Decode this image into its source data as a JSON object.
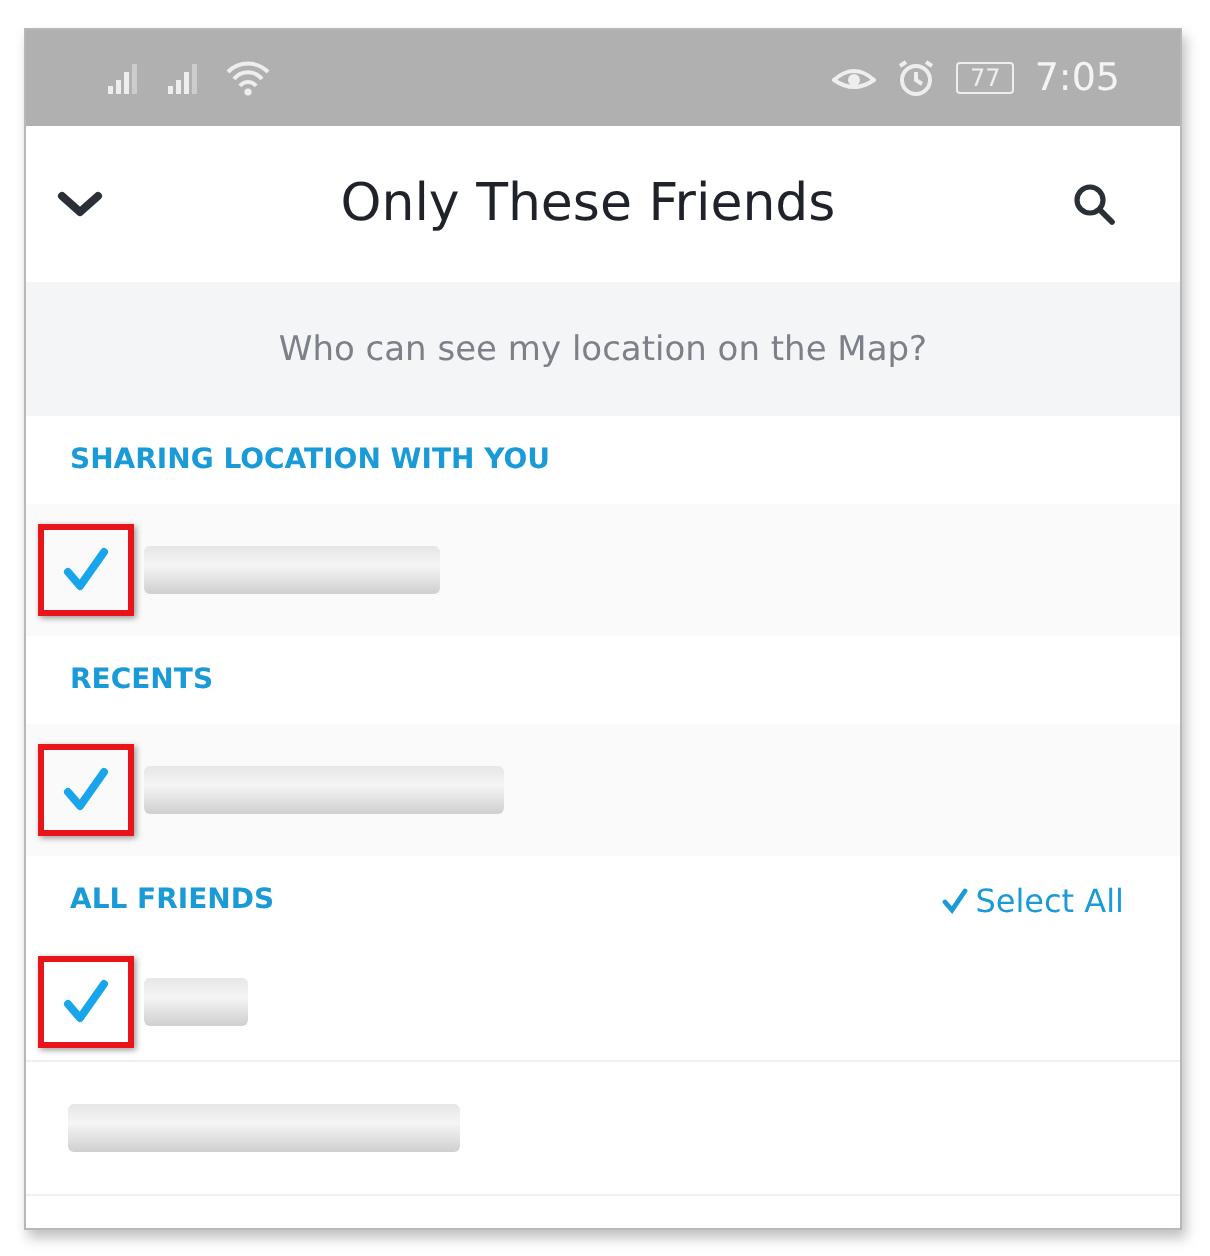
{
  "status_bar": {
    "battery": "77",
    "time": "7:05"
  },
  "header": {
    "title": "Only These Friends"
  },
  "prompt": "Who can see my location on the Map?",
  "sections": [
    {
      "heading": "SHARING LOCATION WITH YOU",
      "items": [
        {
          "kind": "checkbox",
          "checked": true,
          "highlighted": true
        }
      ]
    },
    {
      "heading": "RECENTS",
      "items": [
        {
          "kind": "checkbox",
          "checked": true,
          "highlighted": true
        }
      ]
    },
    {
      "heading": "ALL FRIENDS",
      "action": "Select All",
      "items": [
        {
          "kind": "checkbox",
          "checked": true,
          "highlighted": true
        },
        {
          "kind": "plain"
        }
      ]
    }
  ]
}
